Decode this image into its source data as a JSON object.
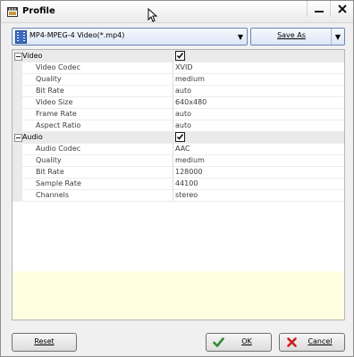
{
  "window": {
    "title": "Profile"
  },
  "toolbar": {
    "format_value": "MP4-MPEG-4 Video(*.mp4)",
    "save_as_label": "Save As"
  },
  "properties": {
    "video": {
      "label": "Video",
      "enabled": true,
      "rows": [
        {
          "name": "Video Codec",
          "value": "XVID"
        },
        {
          "name": "Quality",
          "value": "medium"
        },
        {
          "name": "Bit Rate",
          "value": "auto"
        },
        {
          "name": "Video Size",
          "value": "640x480"
        },
        {
          "name": "Frame Rate",
          "value": "auto"
        },
        {
          "name": "Aspect Ratio",
          "value": "auto"
        }
      ]
    },
    "audio": {
      "label": "Audio",
      "enabled": true,
      "rows": [
        {
          "name": "Audio Codec",
          "value": "AAC"
        },
        {
          "name": "Quality",
          "value": "medium"
        },
        {
          "name": "Bit Rate",
          "value": "128000"
        },
        {
          "name": "Sample Rate",
          "value": "44100"
        },
        {
          "name": "Channels",
          "value": "stereo"
        }
      ]
    }
  },
  "buttons": {
    "reset": "Reset",
    "ok": "OK",
    "cancel": "Cancel"
  },
  "colors": {
    "description_panel": "#ffffe1",
    "ok_check": "#2e8b2e",
    "cancel_x": "#cc1f1f"
  },
  "icons": {
    "app": "film-icon",
    "format": "video-file-icon",
    "ok": "check-icon",
    "cancel": "x-icon"
  }
}
